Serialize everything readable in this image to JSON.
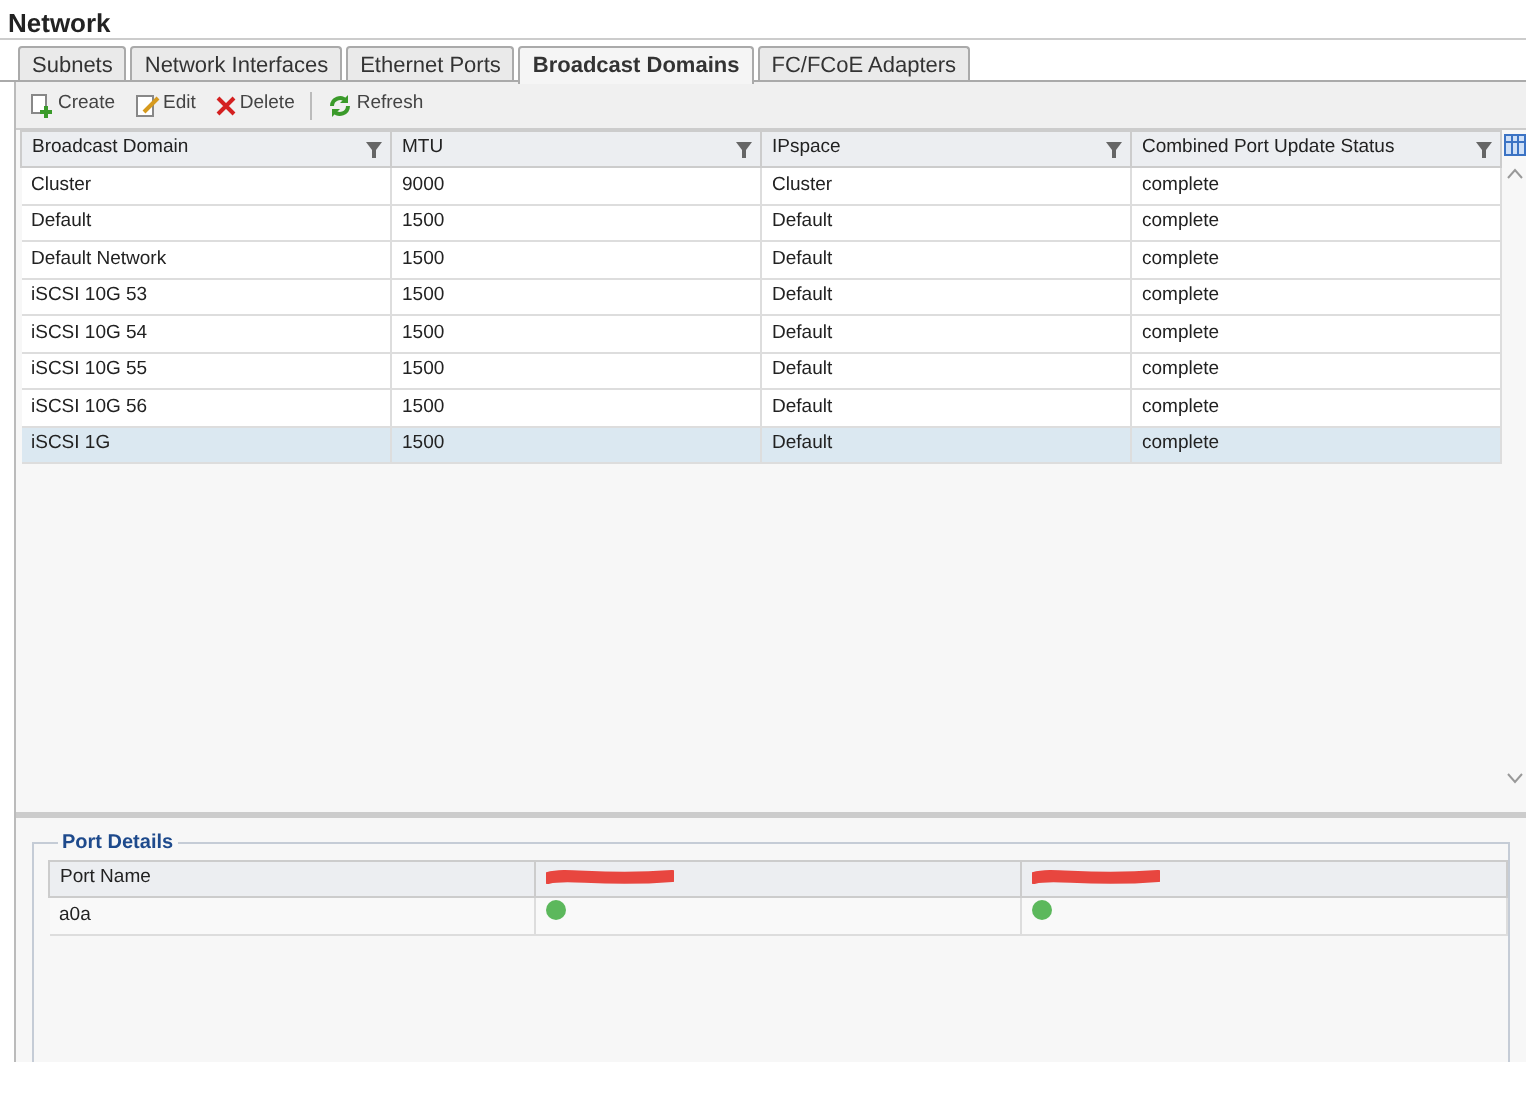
{
  "title": "Network",
  "tabs": [
    {
      "label": "Subnets",
      "selected": false
    },
    {
      "label": "Network Interfaces",
      "selected": false
    },
    {
      "label": "Ethernet Ports",
      "selected": false
    },
    {
      "label": "Broadcast Domains",
      "selected": true
    },
    {
      "label": "FC/FCoE Adapters",
      "selected": false
    }
  ],
  "toolbar": [
    {
      "kind": "create",
      "label": "Create"
    },
    {
      "kind": "edit",
      "label": "Edit"
    },
    {
      "kind": "delete",
      "label": "Delete"
    },
    {
      "kind": "refresh",
      "label": "Refresh"
    }
  ],
  "table": {
    "columns": [
      "Broadcast Domain",
      "MTU",
      "IPspace",
      "Combined Port Update Status"
    ],
    "rows": [
      {
        "cells": [
          "Cluster",
          "9000",
          "Cluster",
          "complete"
        ],
        "selected": false
      },
      {
        "cells": [
          "Default",
          "1500",
          "Default",
          "complete"
        ],
        "selected": false
      },
      {
        "cells": [
          "Default Network",
          "1500",
          "Default",
          "complete"
        ],
        "selected": false
      },
      {
        "cells": [
          "iSCSI 10G 53",
          "1500",
          "Default",
          "complete"
        ],
        "selected": false
      },
      {
        "cells": [
          "iSCSI 10G 54",
          "1500",
          "Default",
          "complete"
        ],
        "selected": false
      },
      {
        "cells": [
          "iSCSI 10G 55",
          "1500",
          "Default",
          "complete"
        ],
        "selected": false
      },
      {
        "cells": [
          "iSCSI 10G 56",
          "1500",
          "Default",
          "complete"
        ],
        "selected": false
      },
      {
        "cells": [
          "iSCSI 1G",
          "1500",
          "Default",
          "complete"
        ],
        "selected": true
      }
    ]
  },
  "port_details": {
    "title": "Port Details",
    "columns": [
      {
        "label": "Port Name"
      },
      {
        "redacted": true
      },
      {
        "redacted": true
      }
    ],
    "rows": [
      {
        "port": "a0a",
        "statuses": [
          {
            "color": "#5cb85c"
          },
          {
            "color": "#5cb85c"
          }
        ]
      }
    ]
  }
}
